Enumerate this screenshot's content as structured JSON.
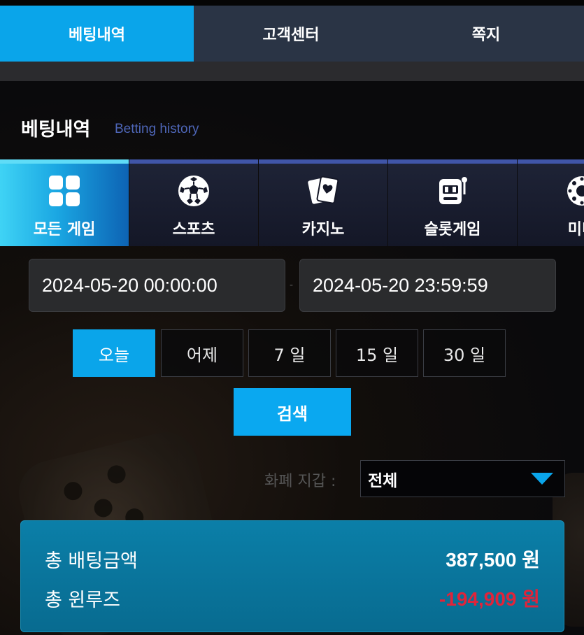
{
  "top_tabs": [
    {
      "label": "베팅내역"
    },
    {
      "label": "고객센터"
    },
    {
      "label": "쪽지"
    }
  ],
  "section": {
    "title": "베팅내역",
    "subtitle": "Betting history"
  },
  "game_tabs": [
    {
      "label": "모든 게임",
      "icon": "grid-icon"
    },
    {
      "label": "스포츠",
      "icon": "soccer-ball-icon"
    },
    {
      "label": "카지노",
      "icon": "playing-cards-icon"
    },
    {
      "label": "슬롯게임",
      "icon": "slot-machine-icon"
    },
    {
      "label": "미니",
      "icon": "mini-game-icon"
    }
  ],
  "date_range": {
    "start": "2024-05-20 00:00:00",
    "separator": "-",
    "end": "2024-05-20 23:59:59"
  },
  "range_buttons": [
    {
      "label": "오늘"
    },
    {
      "label": "어제"
    },
    {
      "label": "7 일"
    },
    {
      "label": "15 일"
    },
    {
      "label": "30 일"
    }
  ],
  "search_label": "검색",
  "currency": {
    "label": "화폐 지갑 :",
    "selected": "전체"
  },
  "summary": {
    "total_bet_label": "총 배팅금액",
    "total_bet_value": "387,500 원",
    "total_winloss_label": "총 윈루즈",
    "total_winloss_value": "-194,909 원"
  },
  "colors": {
    "accent": "#0aa5ea",
    "negative": "#e0243a",
    "summary_bg": "#0b7fa8"
  }
}
